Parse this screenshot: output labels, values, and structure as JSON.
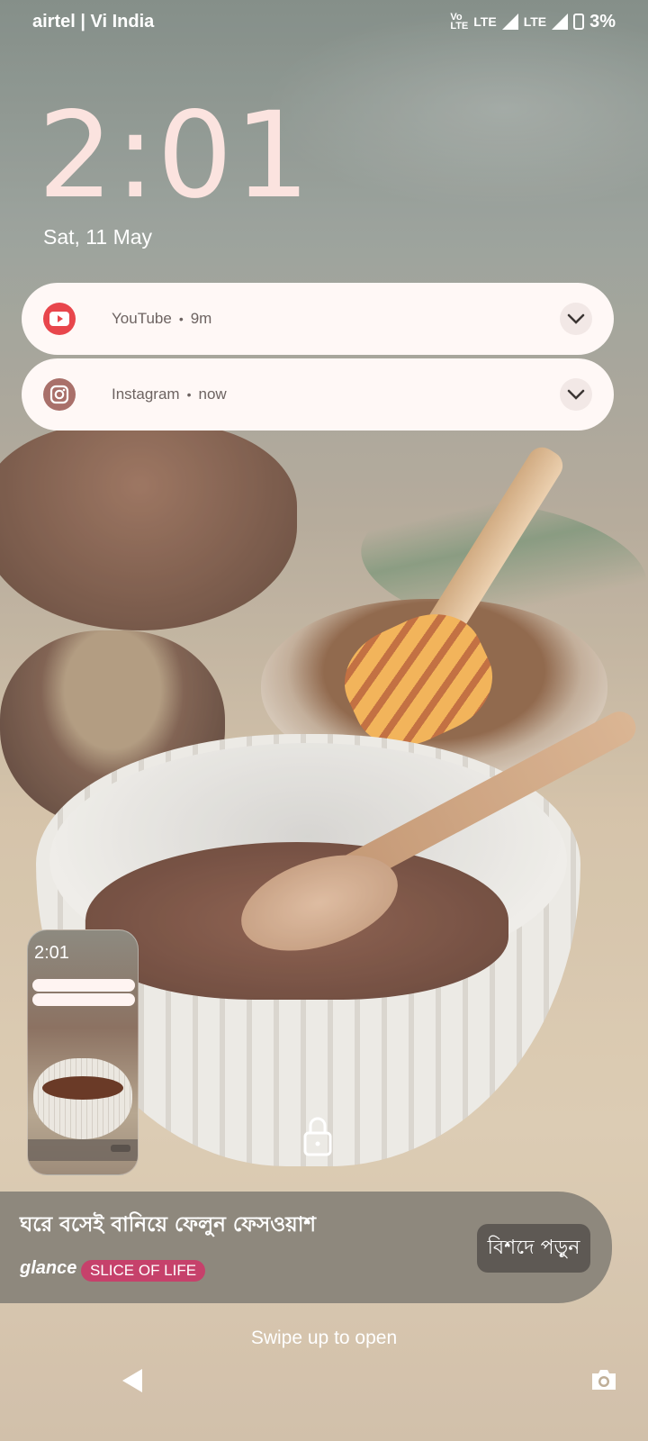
{
  "status_bar": {
    "carrier": "airtel | Vi India",
    "volte_label": "Vo\nLTE",
    "network_1": "LTE",
    "network_2": "LTE",
    "battery": "3%"
  },
  "lockscreen": {
    "time": "2:01",
    "date": "Sat, 11 May"
  },
  "notifications": [
    {
      "app": "YouTube",
      "time": "9m",
      "icon": "youtube-icon"
    },
    {
      "app": "Instagram",
      "time": "now",
      "icon": "instagram-icon"
    }
  ],
  "glance": {
    "headline": "ঘরে বসেই বানিয়ে ফেলুন ফেসওয়াশ",
    "brand": "glance",
    "tag": "SLICE OF LIFE",
    "button": "বিশদে পড়ুন"
  },
  "footer": {
    "hint": "Swipe up to open"
  },
  "preview": {
    "time": "2:01"
  },
  "colors": {
    "youtube": "#e8464c",
    "instagram": "#a9706a",
    "tag": "#c6416b",
    "notification_bg": "#fff8f6"
  }
}
